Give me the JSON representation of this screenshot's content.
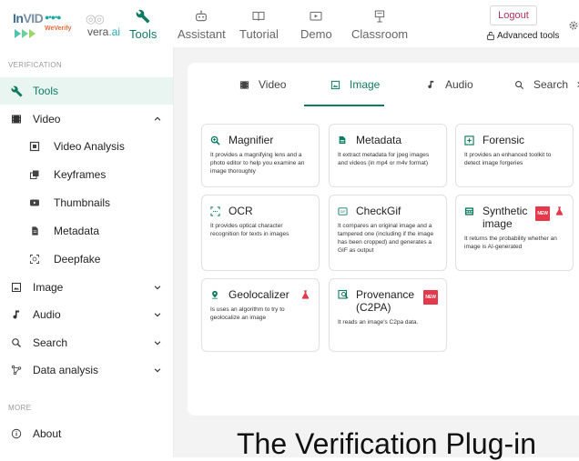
{
  "header": {
    "logo_invid": "InVID",
    "logo_weverify": "WeVerify",
    "logo_vera": "vera.ai",
    "nav": [
      {
        "label": "Tools",
        "icon": "wrench-icon"
      },
      {
        "label": "Assistant",
        "icon": "robot-icon"
      },
      {
        "label": "Tutorial",
        "icon": "book-icon"
      },
      {
        "label": "Demo",
        "icon": "demo-icon"
      },
      {
        "label": "Classroom",
        "icon": "classroom-icon"
      }
    ],
    "active_nav": "Tools",
    "logout_label": "Logout",
    "advanced_tools_label": "Advanced tools"
  },
  "sidebar": {
    "section_verification": "VERIFICATION",
    "section_more": "MORE",
    "items": [
      {
        "label": "Tools",
        "icon": "wrench-icon",
        "active": true
      },
      {
        "label": "Video",
        "icon": "film-icon",
        "expanded": true
      },
      {
        "label": "Video Analysis",
        "icon": "video-analysis-icon"
      },
      {
        "label": "Keyframes",
        "icon": "keyframes-icon"
      },
      {
        "label": "Thumbnails",
        "icon": "youtube-icon"
      },
      {
        "label": "Metadata",
        "icon": "document-icon"
      },
      {
        "label": "Deepfake",
        "icon": "face-scan-icon"
      },
      {
        "label": "Image",
        "icon": "image-icon"
      },
      {
        "label": "Audio",
        "icon": "music-note-icon"
      },
      {
        "label": "Search",
        "icon": "search-icon"
      },
      {
        "label": "Data analysis",
        "icon": "network-icon"
      },
      {
        "label": "About",
        "icon": "info-icon"
      }
    ]
  },
  "tabs": [
    {
      "label": "Video",
      "icon": "film-icon"
    },
    {
      "label": "Image",
      "icon": "image-icon",
      "active": true
    },
    {
      "label": "Audio",
      "icon": "music-note-icon"
    },
    {
      "label": "Search",
      "icon": "search-icon"
    }
  ],
  "cards": [
    {
      "title": "Magnifier",
      "icon": "magnifier-icon",
      "desc": "It provides a magnifying lens and a photo editor to help you examine an image thoroughly"
    },
    {
      "title": "Metadata",
      "icon": "document-icon",
      "desc": "It extract metadata for jpeg images and videos (in mp4 or m4v format)"
    },
    {
      "title": "Forensic",
      "icon": "forensic-icon",
      "desc": "It provides an enhanced toolkit to detect image forgeries"
    },
    {
      "title": "OCR",
      "icon": "ocr-icon",
      "desc": "It provides optical character recognition for texts in images"
    },
    {
      "title": "CheckGif",
      "icon": "gif-icon",
      "desc": "It compares an original image and a tampered one (including if the image has been cropped) and generates a GIF as output"
    },
    {
      "title": "Synthetic image",
      "icon": "synthetic-icon",
      "desc": "It returns the probability whether an image is AI-generated",
      "badge": "NEW"
    },
    {
      "title": "Geolocalizer",
      "icon": "pin-icon",
      "desc": "Is uses an algorithm to try to geolocalize an image"
    },
    {
      "title": "Provenance (C2PA)",
      "icon": "provenance-icon",
      "desc": "It reads an image's C2pa data.",
      "badge": "NEW"
    }
  ],
  "footer_title": "The Verification Plug-in",
  "colors": {
    "accent": "#0f7b62",
    "logout": "#b22d5b",
    "badge": "#e4394a",
    "flask": "#e4394a"
  }
}
